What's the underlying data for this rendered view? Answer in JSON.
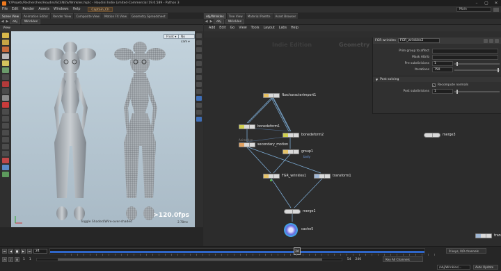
{
  "window": {
    "title": "Y:/Projets/Recherches/Houdini/SCENES/Wrinkles.hiplc - Houdini Indie Limited-Commercial 19.0.589 - Python 3",
    "controls": [
      "–",
      "▢",
      "✕"
    ]
  },
  "menubar": {
    "items": [
      "File",
      "Edit",
      "Render",
      "Assets",
      "Windows",
      "Help"
    ],
    "desktop": "Captain_Ch",
    "workspace": "Main"
  },
  "left_tabs": [
    "Scene View",
    "Animation Editor",
    "Render View",
    "Composite View",
    "Motion FX View",
    "Geometry Spreadsheet"
  ],
  "right_tabs": [
    "obj/Wrinkles",
    "Tree View",
    "Material Palette",
    "Asset Browser"
  ],
  "viewer": {
    "path": [
      "obj",
      "Wrinkles"
    ],
    "title": "View",
    "cam_left": "Front ▾",
    "cam_right": "No cam ▾",
    "fps": ">120.0fps",
    "fps_sub": "2.78ms",
    "status": "Toggle Shaded/Wire-over-shaded"
  },
  "network": {
    "path": [
      "obj",
      "Wrinkles"
    ],
    "menu": [
      "Add",
      "Edit",
      "Go",
      "View",
      "Tools",
      "Layout",
      "Labs",
      "Help"
    ],
    "watermark_indie": "Indie Edition",
    "watermark_context": "Geometry",
    "nodes": {
      "fbxcharacterimport1": "fbxcharacterimport1",
      "bonedeform1": "bonedeform1",
      "bonedeform2": "bonedeform2",
      "secondary_motion": "secondary_motion",
      "secondary_motion_sub": "Animation",
      "group1": "group1",
      "group1_sub": "body",
      "fgr_wrinkles1": "FGR_wrinkles1",
      "transform1": "transform1",
      "merge1": "merge1",
      "merge3": "merge3",
      "cache5": "cache5",
      "transform": "transform"
    }
  },
  "params": {
    "type": "FGR wrinkles",
    "name": "FGR_wrinkles2",
    "rows": [
      {
        "label": "Prim group to affect",
        "value": ""
      },
      {
        "label": "Mask Attrib",
        "value": ""
      },
      {
        "label": "Pre subdivisions",
        "value": "1"
      },
      {
        "label": "Iterations",
        "value": "750"
      }
    ],
    "section": "Post solving",
    "recompute_label": "Recompute normals",
    "post_sub_label": "Post subdivisions",
    "post_sub_value": "1",
    "pre_sub_fraction": 0.05,
    "iterations_fraction": 0.98,
    "post_sub_fraction": 0.05
  },
  "timeline": {
    "current_frame": "24",
    "cursor_label": "24",
    "start": "1",
    "start2": "1",
    "end": "54",
    "end2": "240",
    "keys": "0 keys, 0/0 channels",
    "keys2": "Key All Channels",
    "scene_path": "/obj/Wrinkles/...",
    "auto_update": "Auto Update",
    "playhead_fraction": 0.66
  }
}
